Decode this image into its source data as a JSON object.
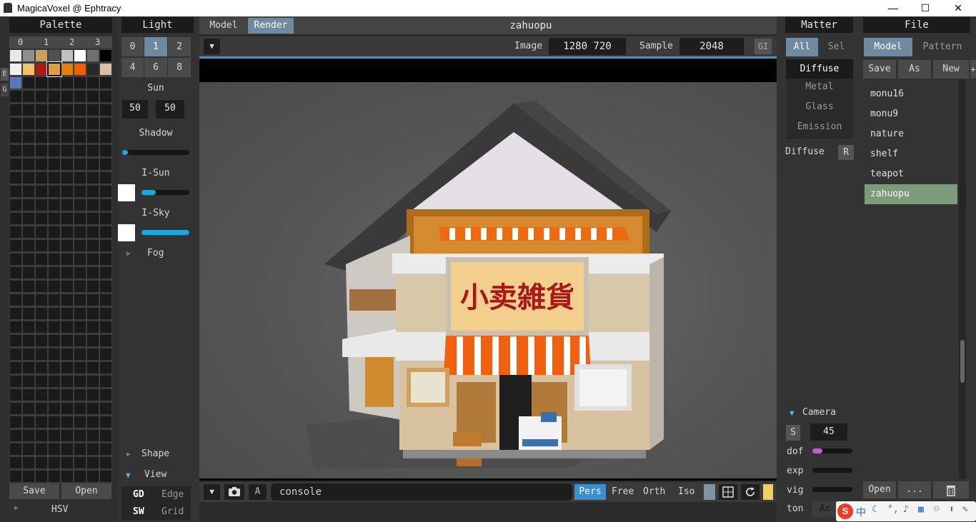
{
  "window": {
    "title": "MagicaVoxel @ Ephtracy",
    "min": "—",
    "max": "☐",
    "close": "✕"
  },
  "palette": {
    "header": "Palette",
    "cols": [
      "0",
      "1",
      "2",
      "3"
    ],
    "side": [
      "E",
      "G"
    ],
    "save": "Save",
    "open": "Open",
    "hsv": "HSV",
    "swatches": [
      "#e8e8e8",
      "#8e8e8e",
      "#c8a060",
      "#505050",
      "#c0c0c0",
      "#ffffff",
      "#707070",
      "#000000",
      "#f0f0f0",
      "#f0c070",
      "#b01818",
      "#e0a040",
      "#e08010",
      "#f06000",
      "#282828",
      "#d8c0a0",
      "#5577bb"
    ]
  },
  "light": {
    "header": "Light",
    "nums": [
      "0",
      "1",
      "2",
      "4",
      "6",
      "8"
    ],
    "sun_label": "Sun",
    "sun_a": "50",
    "sun_b": "50",
    "shadow": "Shadow",
    "isun": "I-Sun",
    "isky": "I-Sky",
    "fog": "Fog",
    "shape": "Shape",
    "view": "View",
    "gd": "GD",
    "edge": "Edge",
    "sw": "SW",
    "grid": "Grid",
    "shadow_value": 0.03,
    "isun_value": 0.3,
    "isky_value": 1.0
  },
  "viewport": {
    "tab_model": "Model",
    "tab_render": "Render",
    "name": "zahuopu",
    "image_label": "Image",
    "image_value": "1280 720",
    "sample_label": "Sample",
    "sample_value": "2048",
    "gi": "GI",
    "dropdown": "▼",
    "a": "A",
    "console": "console",
    "pers": "Pers",
    "free": "Free",
    "orth": "Orth",
    "iso": "Iso",
    "sign": "小卖雑貨"
  },
  "matter": {
    "header": "Matter",
    "all": "All",
    "sel": "Sel",
    "diffuse": "Diffuse",
    "metal": "Metal",
    "glass": "Glass",
    "emission": "Emission",
    "diffuse2": "Diffuse",
    "r": "R",
    "camera": "Camera",
    "s": "S",
    "cam_value": "45",
    "dof": "dof",
    "exp": "exp",
    "vig": "vig",
    "ton": "ton",
    "ac": "Ac"
  },
  "file": {
    "header": "File",
    "model": "Model",
    "pattern": "Pattern",
    "save": "Save",
    "as": "As",
    "new": "New",
    "plus": "+",
    "items": [
      "monu16",
      "monu9",
      "nature",
      "shelf",
      "teapot",
      "zahuopu"
    ],
    "selected": 5,
    "open": "Open",
    "dots": "...",
    "ime": "中"
  }
}
